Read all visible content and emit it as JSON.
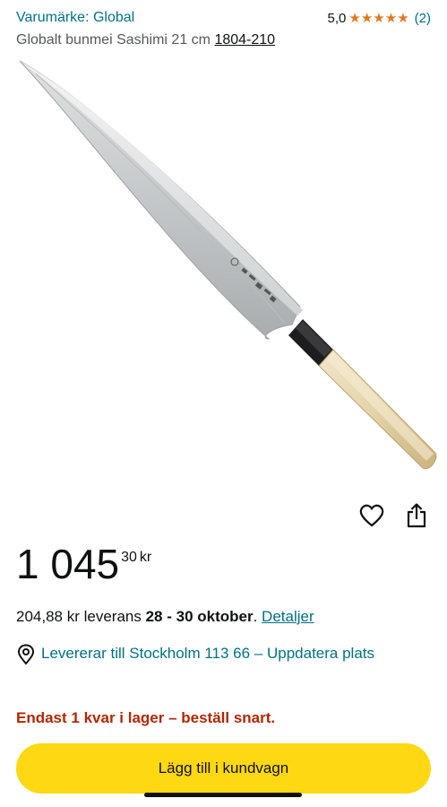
{
  "header": {
    "brand_link": "Varumärke: Global",
    "rating_score": "5,0",
    "rating_stars": 5,
    "rating_stars_display": "★★★★★",
    "rating_count": "(2)",
    "title_text": "Globalt bunmei Sashimi 21 cm ",
    "model_number": "1804-210"
  },
  "product_image": {
    "alt": "Sashimi knife with steel blade and light wooden handle"
  },
  "actions": {
    "wishlist_icon": "heart-icon",
    "share_icon": "share-icon"
  },
  "price": {
    "whole": "1 045",
    "fraction": "30",
    "currency": "kr"
  },
  "delivery": {
    "fee_text": "204,88 kr leverans ",
    "dates": "28 - 30 oktober",
    "period": ". ",
    "details_link": "Detaljer"
  },
  "location": {
    "icon": "location-pin-icon",
    "text": "Levererar till Stockholm 113 66 – Uppdatera plats"
  },
  "stock": {
    "text": "Endast 1 kvar i lager – beställ snart."
  },
  "cart": {
    "button_label": "Lägg till i kundvagn"
  },
  "colors": {
    "link": "#007185",
    "stars": "#de7921",
    "stock_warning": "#b12704",
    "cart_button": "#ffd814"
  }
}
